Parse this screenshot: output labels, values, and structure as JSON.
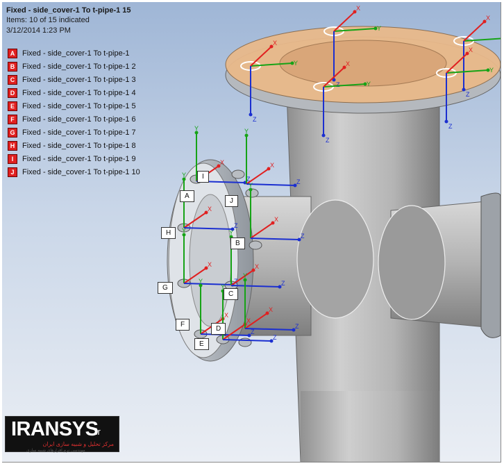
{
  "header": {
    "title": "Fixed - side_cover-1 To t-pipe-1 15",
    "items_indicated": "Items: 10 of 15 indicated",
    "timestamp": "3/12/2014 1:23 PM"
  },
  "legend": [
    {
      "key": "A",
      "label": "Fixed - side_cover-1 To t-pipe-1"
    },
    {
      "key": "B",
      "label": "Fixed - side_cover-1 To t-pipe-1 2"
    },
    {
      "key": "C",
      "label": "Fixed - side_cover-1 To t-pipe-1 3"
    },
    {
      "key": "D",
      "label": "Fixed - side_cover-1 To t-pipe-1 4"
    },
    {
      "key": "E",
      "label": "Fixed - side_cover-1 To t-pipe-1 5"
    },
    {
      "key": "F",
      "label": "Fixed - side_cover-1 To t-pipe-1 6"
    },
    {
      "key": "G",
      "label": "Fixed - side_cover-1 To t-pipe-1 7"
    },
    {
      "key": "H",
      "label": "Fixed - side_cover-1 To t-pipe-1 8"
    },
    {
      "key": "I",
      "label": "Fixed - side_cover-1 To t-pipe-1 9"
    },
    {
      "key": "J",
      "label": "Fixed - side_cover-1 To t-pipe-1 10"
    }
  ],
  "callouts": [
    "A",
    "B",
    "C",
    "D",
    "E",
    "F",
    "G",
    "H",
    "I",
    "J"
  ],
  "axis_labels": {
    "x": "X",
    "y": "Y",
    "z": "Z"
  },
  "colors": {
    "legend_badge": "#e02020",
    "axis_x": "#e02020",
    "axis_y": "#16a316",
    "axis_z": "#1b2fd0",
    "flange_highlight": "#e9b98a",
    "pipe": "#b9b9b9"
  },
  "logo": {
    "main": "IRANSYS",
    "suffix": ".ir",
    "tagline": "مرکز تحلیل و شبیه سازی ایران",
    "subtext": "مهندسی نرم افزارهای شبیه سازی"
  }
}
